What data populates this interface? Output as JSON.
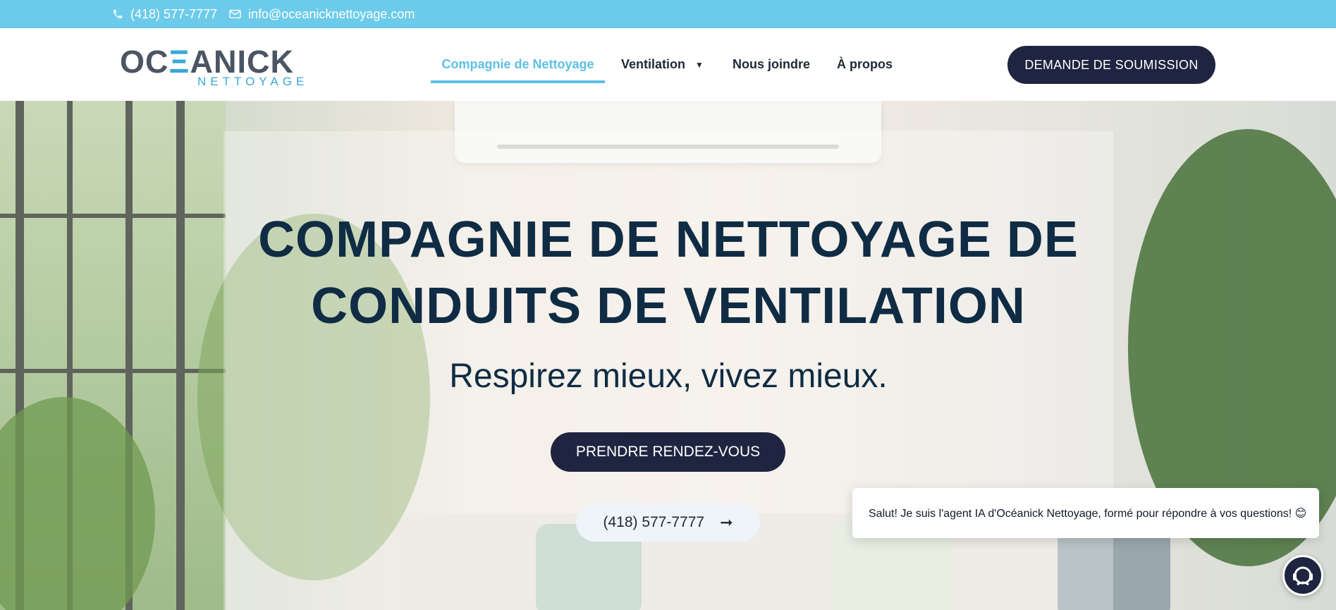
{
  "topbar": {
    "phone": "(418) 577-7777",
    "email": "info@oceanicknettoyage.com",
    "background": "#6ccbea"
  },
  "logo": {
    "main_left": "OC",
    "main_accent": "Ξ",
    "main_right": "ANICK",
    "sub": "NETTOYAGE"
  },
  "nav": {
    "items": [
      {
        "label": "Compagnie de Nettoyage",
        "active": true
      },
      {
        "label": "Ventilation",
        "has_dropdown": true
      },
      {
        "label": "Nous joindre"
      },
      {
        "label": "À propos"
      }
    ],
    "cta": "DEMANDE DE SOUMISSION"
  },
  "hero": {
    "title_line1": "COMPAGNIE DE NETTOYAGE DE",
    "title_line2": "CONDUITS DE VENTILATION",
    "subtitle": "Respirez mieux, vivez mieux.",
    "primary_button": "PRENDRE RENDEZ-VOUS",
    "phone_button": "(418) 577-7777"
  },
  "chat": {
    "message": "Salut! Je suis l'agent IA d'Océanick Nettoyage, formé pour répondre à vos questions! 😊"
  },
  "colors": {
    "accent": "#5cc0e5",
    "navy": "#1f2540",
    "title": "#0f2c44"
  }
}
